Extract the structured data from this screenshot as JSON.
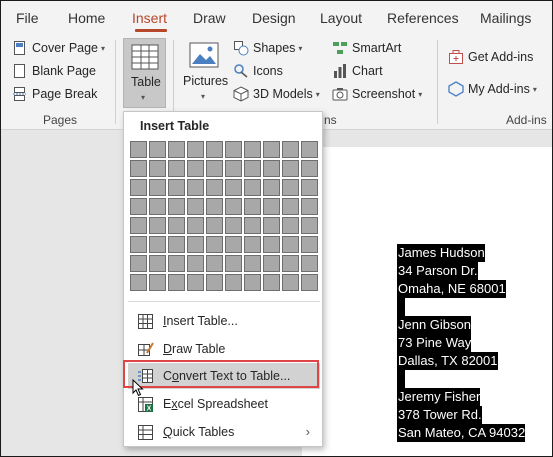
{
  "tabs": [
    "File",
    "Home",
    "Insert",
    "Draw",
    "Design",
    "Layout",
    "References",
    "Mailings"
  ],
  "active_tab": "Insert",
  "ribbon": {
    "pages_group": {
      "label": "Pages",
      "items": [
        "Cover Page",
        "Blank Page",
        "Page Break"
      ]
    },
    "tables_group": {
      "table_label": "Table"
    },
    "illustrations_group": {
      "label_fragment": "ns",
      "pictures_label": "Pictures",
      "shapes_label": "Shapes",
      "icons_label": "Icons",
      "models_label": "3D Models",
      "smartart_label": "SmartArt",
      "chart_label": "Chart",
      "screenshot_label": "Screenshot"
    },
    "addins_group": {
      "label": "Add-ins",
      "get_label": "Get Add-ins",
      "my_label": "My Add-ins"
    }
  },
  "insert_table_menu": {
    "title": "Insert Table",
    "grid": {
      "columns": 10,
      "rows": 8
    },
    "items": [
      {
        "label": "Insert Table...",
        "icon": "table-grid-icon"
      },
      {
        "label": "Draw Table",
        "icon": "pencil-table-icon"
      },
      {
        "label": "Convert Text to Table...",
        "icon": "convert-text-table-icon"
      },
      {
        "label": "Excel Spreadsheet",
        "icon": "excel-icon"
      },
      {
        "label": "Quick Tables",
        "icon": "quick-tables-icon"
      }
    ],
    "highlighted_item": "Convert Text to Table..."
  },
  "document": {
    "selected_lines": [
      "James Hudson",
      "34 Parson Dr.",
      "Omaha, NE 68001",
      "",
      "Jenn Gibson",
      "73 Pine Way",
      "Dallas, TX 82001",
      "",
      "Jeremy Fisher",
      "378 Tower Rd.",
      "San Mateo, CA 94032"
    ]
  },
  "colors": {
    "accent": "#b7472a",
    "highlight_border": "#e04545",
    "selection": "#000000"
  }
}
